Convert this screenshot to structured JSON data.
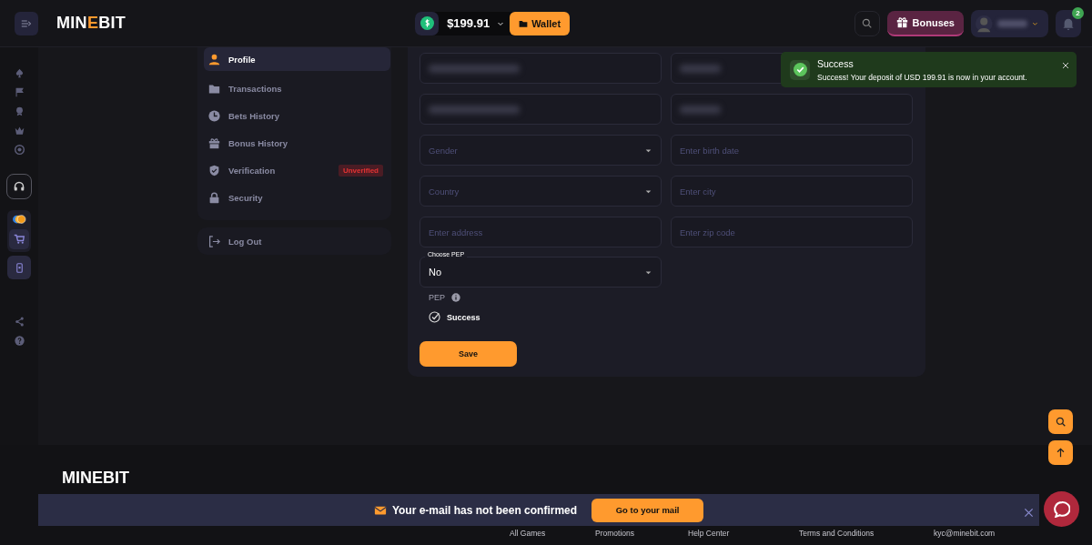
{
  "header": {
    "logo": "MINEBIT",
    "balance": "$199.91",
    "wallet_button": "Wallet",
    "bonuses_button": "Bonuses",
    "notification_count": "2"
  },
  "profile_menu": {
    "items": [
      {
        "label": "Profile",
        "selected": true
      },
      {
        "label": "Transactions",
        "selected": false
      },
      {
        "label": "Bets History",
        "selected": false
      },
      {
        "label": "Bonus History",
        "selected": false
      },
      {
        "label": "Verification",
        "selected": false,
        "badge": "Unverified"
      },
      {
        "label": "Security",
        "selected": false
      }
    ],
    "logout": "Log Out"
  },
  "form": {
    "fields": [
      {
        "kind": "redacted"
      },
      {
        "kind": "redacted"
      },
      {
        "kind": "redacted"
      },
      {
        "kind": "redacted"
      },
      {
        "kind": "select",
        "placeholder": "Gender"
      },
      {
        "kind": "input",
        "placeholder": "Enter birth date"
      },
      {
        "kind": "select",
        "placeholder": "Country"
      },
      {
        "kind": "input",
        "placeholder": "Enter city"
      },
      {
        "kind": "input",
        "placeholder": "Enter address"
      },
      {
        "kind": "input",
        "placeholder": "Enter zip code"
      }
    ],
    "pep_select": {
      "label": "Choose PEP",
      "value": "No"
    },
    "pep_label": "PEP",
    "pep_status": "Success",
    "save_button": "Save"
  },
  "toast": {
    "title": "Success",
    "message": "Success! Your deposit of USD 199.91 is now in your account."
  },
  "email_banner": {
    "message": "Your e-mail has not been confirmed",
    "button": "Go to your mail"
  },
  "footer": {
    "logo": "MINEBIT",
    "links": [
      "All Games",
      "Promotions",
      "Help Center",
      "Terms and Conditions",
      "kyc@minebit.com"
    ]
  }
}
